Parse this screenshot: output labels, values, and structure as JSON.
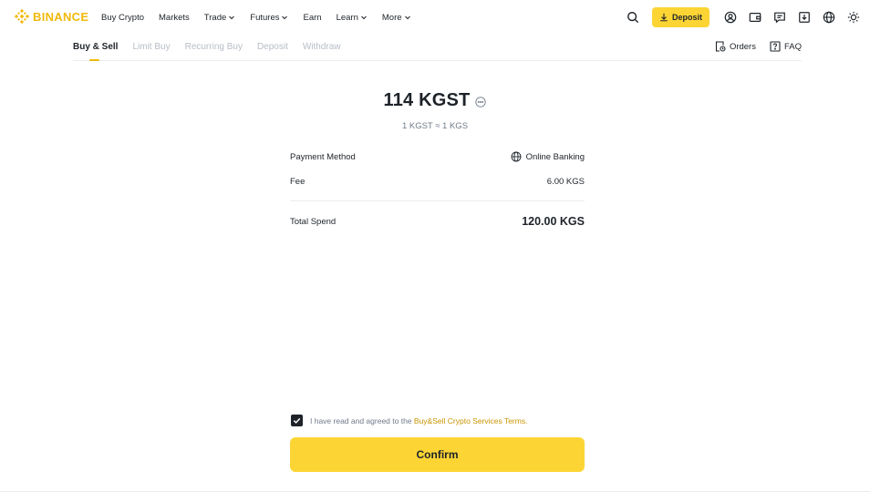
{
  "brand": {
    "name": "BINANCE",
    "accent": "#F0B90B",
    "button_color": "#FCD535"
  },
  "topnav": {
    "items": [
      {
        "label": "Buy Crypto",
        "dropdown": false
      },
      {
        "label": "Markets",
        "dropdown": false
      },
      {
        "label": "Trade",
        "dropdown": true
      },
      {
        "label": "Futures",
        "dropdown": true
      },
      {
        "label": "Earn",
        "dropdown": false
      },
      {
        "label": "Learn",
        "dropdown": true
      },
      {
        "label": "More",
        "dropdown": true
      }
    ],
    "deposit_label": "Deposit",
    "icons": [
      "search-icon",
      "deposit-download-icon",
      "user-profile-icon",
      "wallet-icon",
      "messages-icon",
      "app-download-icon",
      "language-globe-icon",
      "theme-sun-icon"
    ]
  },
  "subnav": {
    "tabs": [
      "Buy & Sell",
      "Limit Buy",
      "Recurring Buy",
      "Deposit",
      "Withdraw"
    ],
    "active_tab": "Buy & Sell",
    "orders_label": "Orders",
    "faq_label": "FAQ"
  },
  "order": {
    "amount": "114 KGST",
    "rate": "1 KGST ≈ 1 KGS",
    "payment_method_label": "Payment Method",
    "payment_method_value": "Online Banking",
    "fee_label": "Fee",
    "fee_value": "6.00 KGS",
    "total_label": "Total Spend",
    "total_value": "120.00 KGS"
  },
  "agreement": {
    "checked": true,
    "text": "I have read and agreed to the",
    "link_text": "Buy&Sell Crypto Services Terms."
  },
  "confirm_label": "Confirm"
}
